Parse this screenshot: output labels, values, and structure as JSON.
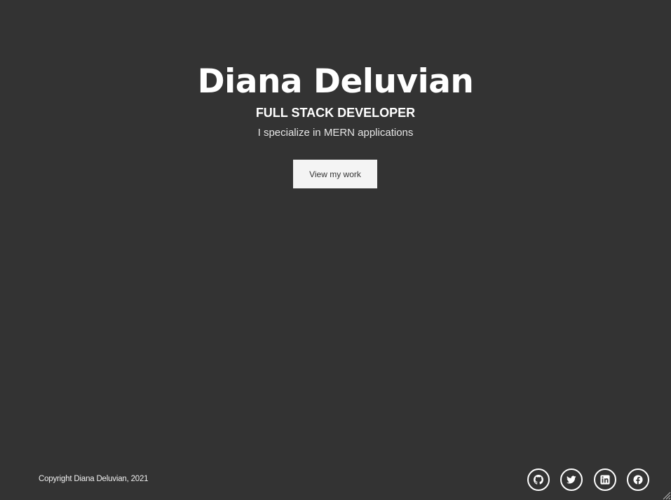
{
  "hero": {
    "name": "Diana Deluvian",
    "role": "FULL STACK DEVELOPER",
    "tagline": "I specialize in MERN applications",
    "cta_label": "View my work"
  },
  "footer": {
    "copyright": "Copyright Diana Deluvian, 2021",
    "social_links": [
      {
        "icon": "github-icon"
      },
      {
        "icon": "twitter-icon"
      },
      {
        "icon": "linkedin-icon"
      },
      {
        "icon": "facebook-icon"
      }
    ]
  },
  "colors": {
    "background": "#333333",
    "text": "#ffffff",
    "button_background": "#f4f4f4",
    "button_text": "#333333"
  }
}
